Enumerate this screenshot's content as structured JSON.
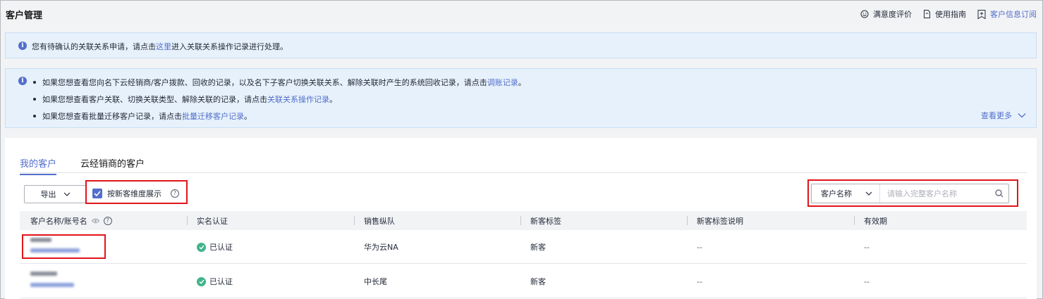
{
  "header": {
    "title": "客户管理",
    "actions": [
      {
        "label": "满意度评价",
        "icon": "smiley-icon"
      },
      {
        "label": "使用指南",
        "icon": "document-icon"
      },
      {
        "label": "客户信息订阅",
        "icon": "bookmark-plus-icon"
      }
    ]
  },
  "notice1": {
    "before": "您有待确认的关联关系申请，请点击",
    "link": "这里",
    "after": "进入关联关系操作记录进行处理。"
  },
  "notice2": {
    "items": [
      {
        "before": "如果您想查看您向名下云经销商/客户拨款、回收的记录，以及名下子客户切换关联关系、解除关联时产生的系统回收记录，请点击",
        "link": "调账记录",
        "after": "。"
      },
      {
        "before": "如果您想查看客户关联、切换关联类型、解除关联的记录，请点击",
        "link": "关联关系操作记录",
        "after": "。"
      },
      {
        "before": "如果您想查看批量迁移客户记录，请点击",
        "link": "批量迁移客户记录",
        "after": "。"
      }
    ],
    "more": "查看更多"
  },
  "tabs": [
    {
      "label": "我的客户",
      "active": true
    },
    {
      "label": "云经销商的客户",
      "active": false
    }
  ],
  "toolbar": {
    "export_label": "导出",
    "checkbox_label": "按新客维度展示",
    "checkbox_checked": true,
    "search_field": "客户名称",
    "search_placeholder": "请输入完整客户名称"
  },
  "table": {
    "columns": [
      "客户名称/账号名",
      "实名认证",
      "销售纵队",
      "新客标签",
      "新客标签说明",
      "有效期"
    ],
    "rows": [
      {
        "verify": "已认证",
        "team": "华为云NA",
        "tag": "新客",
        "tag_desc": "--",
        "validity": "--"
      },
      {
        "verify": "已认证",
        "team": "中长尾",
        "tag": "新客",
        "tag_desc": "--",
        "validity": "--"
      }
    ]
  },
  "colors": {
    "accent": "#526ecc",
    "highlight": "#e0151a",
    "success": "#3fb589"
  }
}
